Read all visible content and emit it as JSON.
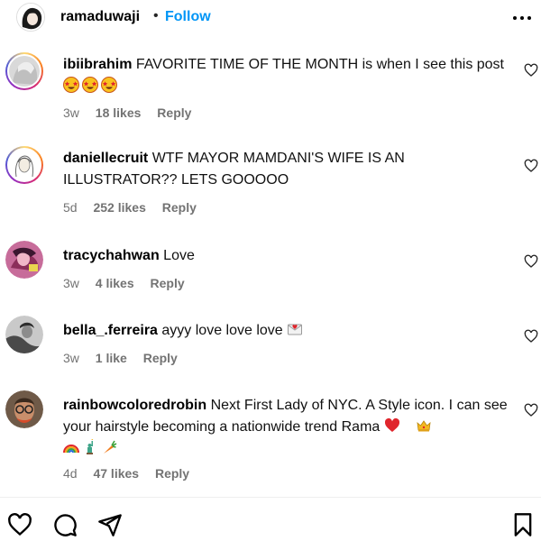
{
  "header": {
    "username": "ramaduwaji",
    "separator": "•",
    "follow_label": "Follow",
    "more_icon": "more-horizontal-icon"
  },
  "comments": [
    {
      "username": "ibiibrahim",
      "text": "FAVORITE TIME OF THE MONTH is when I see this post",
      "emojis": [
        "star-struck",
        "star-struck",
        "star-struck"
      ],
      "time": "3w",
      "likes": "18 likes",
      "reply": "Reply"
    },
    {
      "username": "daniellecruit",
      "text": "WTF MAYOR MAMDANI'S WIFE IS AN ILLUSTRATOR?? LETS GOOOOO",
      "time": "5d",
      "likes": "252 likes",
      "reply": "Reply"
    },
    {
      "username": "tracychahwan",
      "text": "Love",
      "time": "3w",
      "likes": "4 likes",
      "reply": "Reply"
    },
    {
      "username": "bella_.ferreira",
      "text": "ayyy love love love",
      "emojis": [
        "love-letter"
      ],
      "time": "3w",
      "likes": "1 like",
      "reply": "Reply"
    },
    {
      "username": "rainbowcoloredrobin",
      "text": "Next First Lady of NYC. A Style icon. I can see your hairstyle becoming a nationwide trend Rama",
      "emojis": [
        "red-heart",
        "crown",
        "rainbow",
        "statue-of-liberty",
        "carrot"
      ],
      "time": "4d",
      "likes": "47 likes",
      "reply": "Reply"
    }
  ],
  "actions": [
    "like-icon",
    "comment-icon",
    "share-icon",
    "save-icon"
  ],
  "colors": {
    "follow": "#0095f6",
    "meta": "#737373"
  }
}
